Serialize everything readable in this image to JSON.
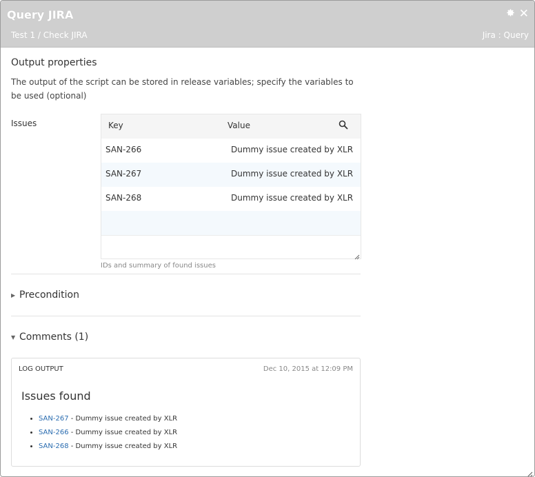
{
  "header": {
    "title": "Query JIRA",
    "breadcrumb": "Test 1 / Check JIRA",
    "task_type": "Jira : Query",
    "gear_icon": "gear-icon",
    "close_icon": "close-icon"
  },
  "output": {
    "section_title": "Output properties",
    "description": "The output of the script can be stored in release variables; specify the variables to be used (optional)",
    "field_label": "Issues",
    "table": {
      "columns": [
        "Key",
        "Value"
      ],
      "rows": [
        {
          "key": "SAN-266",
          "value": "Dummy issue created by XLR"
        },
        {
          "key": "SAN-267",
          "value": "Dummy issue created by XLR"
        },
        {
          "key": "SAN-268",
          "value": "Dummy issue created by XLR"
        }
      ]
    },
    "hint": "IDs and summary of found issues"
  },
  "precondition": {
    "label": "Precondition"
  },
  "comments": {
    "label": "Comments (1)",
    "log": {
      "header": "LOG OUTPUT",
      "date": "Dec 10, 2015 at 12:09 PM",
      "title": "Issues found",
      "items": [
        {
          "key": "SAN-267",
          "text": " - Dummy issue created by XLR"
        },
        {
          "key": "SAN-266",
          "text": " - Dummy issue created by XLR"
        },
        {
          "key": "SAN-268",
          "text": " - Dummy issue created by XLR"
        }
      ]
    }
  },
  "colors": {
    "header_bg": "#cfcfcf",
    "link": "#2a6cb0",
    "row_alt": "#f4f9fd"
  }
}
